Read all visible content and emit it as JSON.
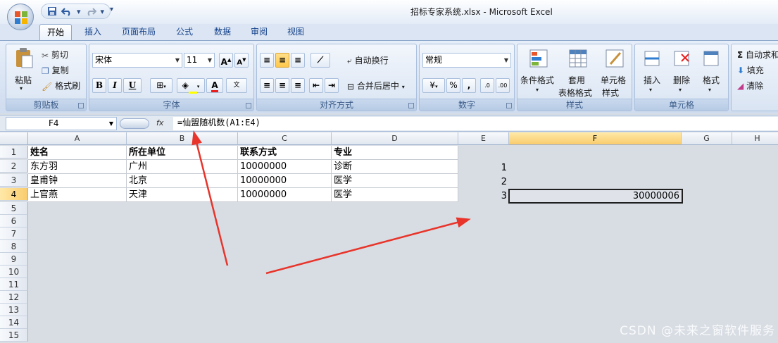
{
  "window": {
    "title": "招标专家系统.xlsx - Microsoft Excel"
  },
  "tabs": [
    "开始",
    "插入",
    "页面布局",
    "公式",
    "数据",
    "审阅",
    "视图"
  ],
  "clipboard": {
    "paste": "粘贴",
    "cut": "剪切",
    "copy": "复制",
    "format_painter": "格式刷",
    "label": "剪贴板"
  },
  "font": {
    "name": "宋体",
    "size": "11",
    "label": "字体",
    "bold": "B",
    "italic": "I",
    "underline": "U"
  },
  "alignment": {
    "wrap": "自动换行",
    "merge": "合并后居中",
    "label": "对齐方式"
  },
  "number": {
    "format": "常规",
    "label": "数字",
    "percent": "%",
    "comma": ","
  },
  "styles": {
    "conditional": "条件格式",
    "table1": "套用",
    "table2": "表格格式",
    "cell1": "单元格",
    "cell2": "样式",
    "label": "样式"
  },
  "cells": {
    "insert": "插入",
    "delete": "删除",
    "format": "格式",
    "label": "单元格"
  },
  "editing": {
    "autosum": "自动求和",
    "fill": "填充",
    "clear": "清除"
  },
  "formula_bar": {
    "name_box": "F4",
    "fx": "fx",
    "formula": "=仙盟随机数(A1:E4)"
  },
  "columns": [
    "A",
    "B",
    "C",
    "D",
    "E",
    "F",
    "G",
    "H"
  ],
  "rows": [
    "1",
    "2",
    "3",
    "4",
    "5",
    "6",
    "7",
    "8",
    "9",
    "10",
    "11",
    "12",
    "13",
    "14",
    "15"
  ],
  "table": {
    "headers": [
      "姓名",
      "所在单位",
      "联系方式",
      "专业"
    ],
    "data": [
      [
        "东方羽",
        "广州",
        "10000000",
        "诊断"
      ],
      [
        "皇甫钟",
        "北京",
        "10000000",
        "医学"
      ],
      [
        "上官燕",
        "天津",
        "10000000",
        "医学"
      ]
    ]
  },
  "e_column": [
    "1",
    "2",
    "3"
  ],
  "f4_value": "30000006",
  "watermark": "CSDN @未来之窗软件服务",
  "colors": {
    "arrow": "#e8342a",
    "selected_header": "#f9cc6d"
  }
}
